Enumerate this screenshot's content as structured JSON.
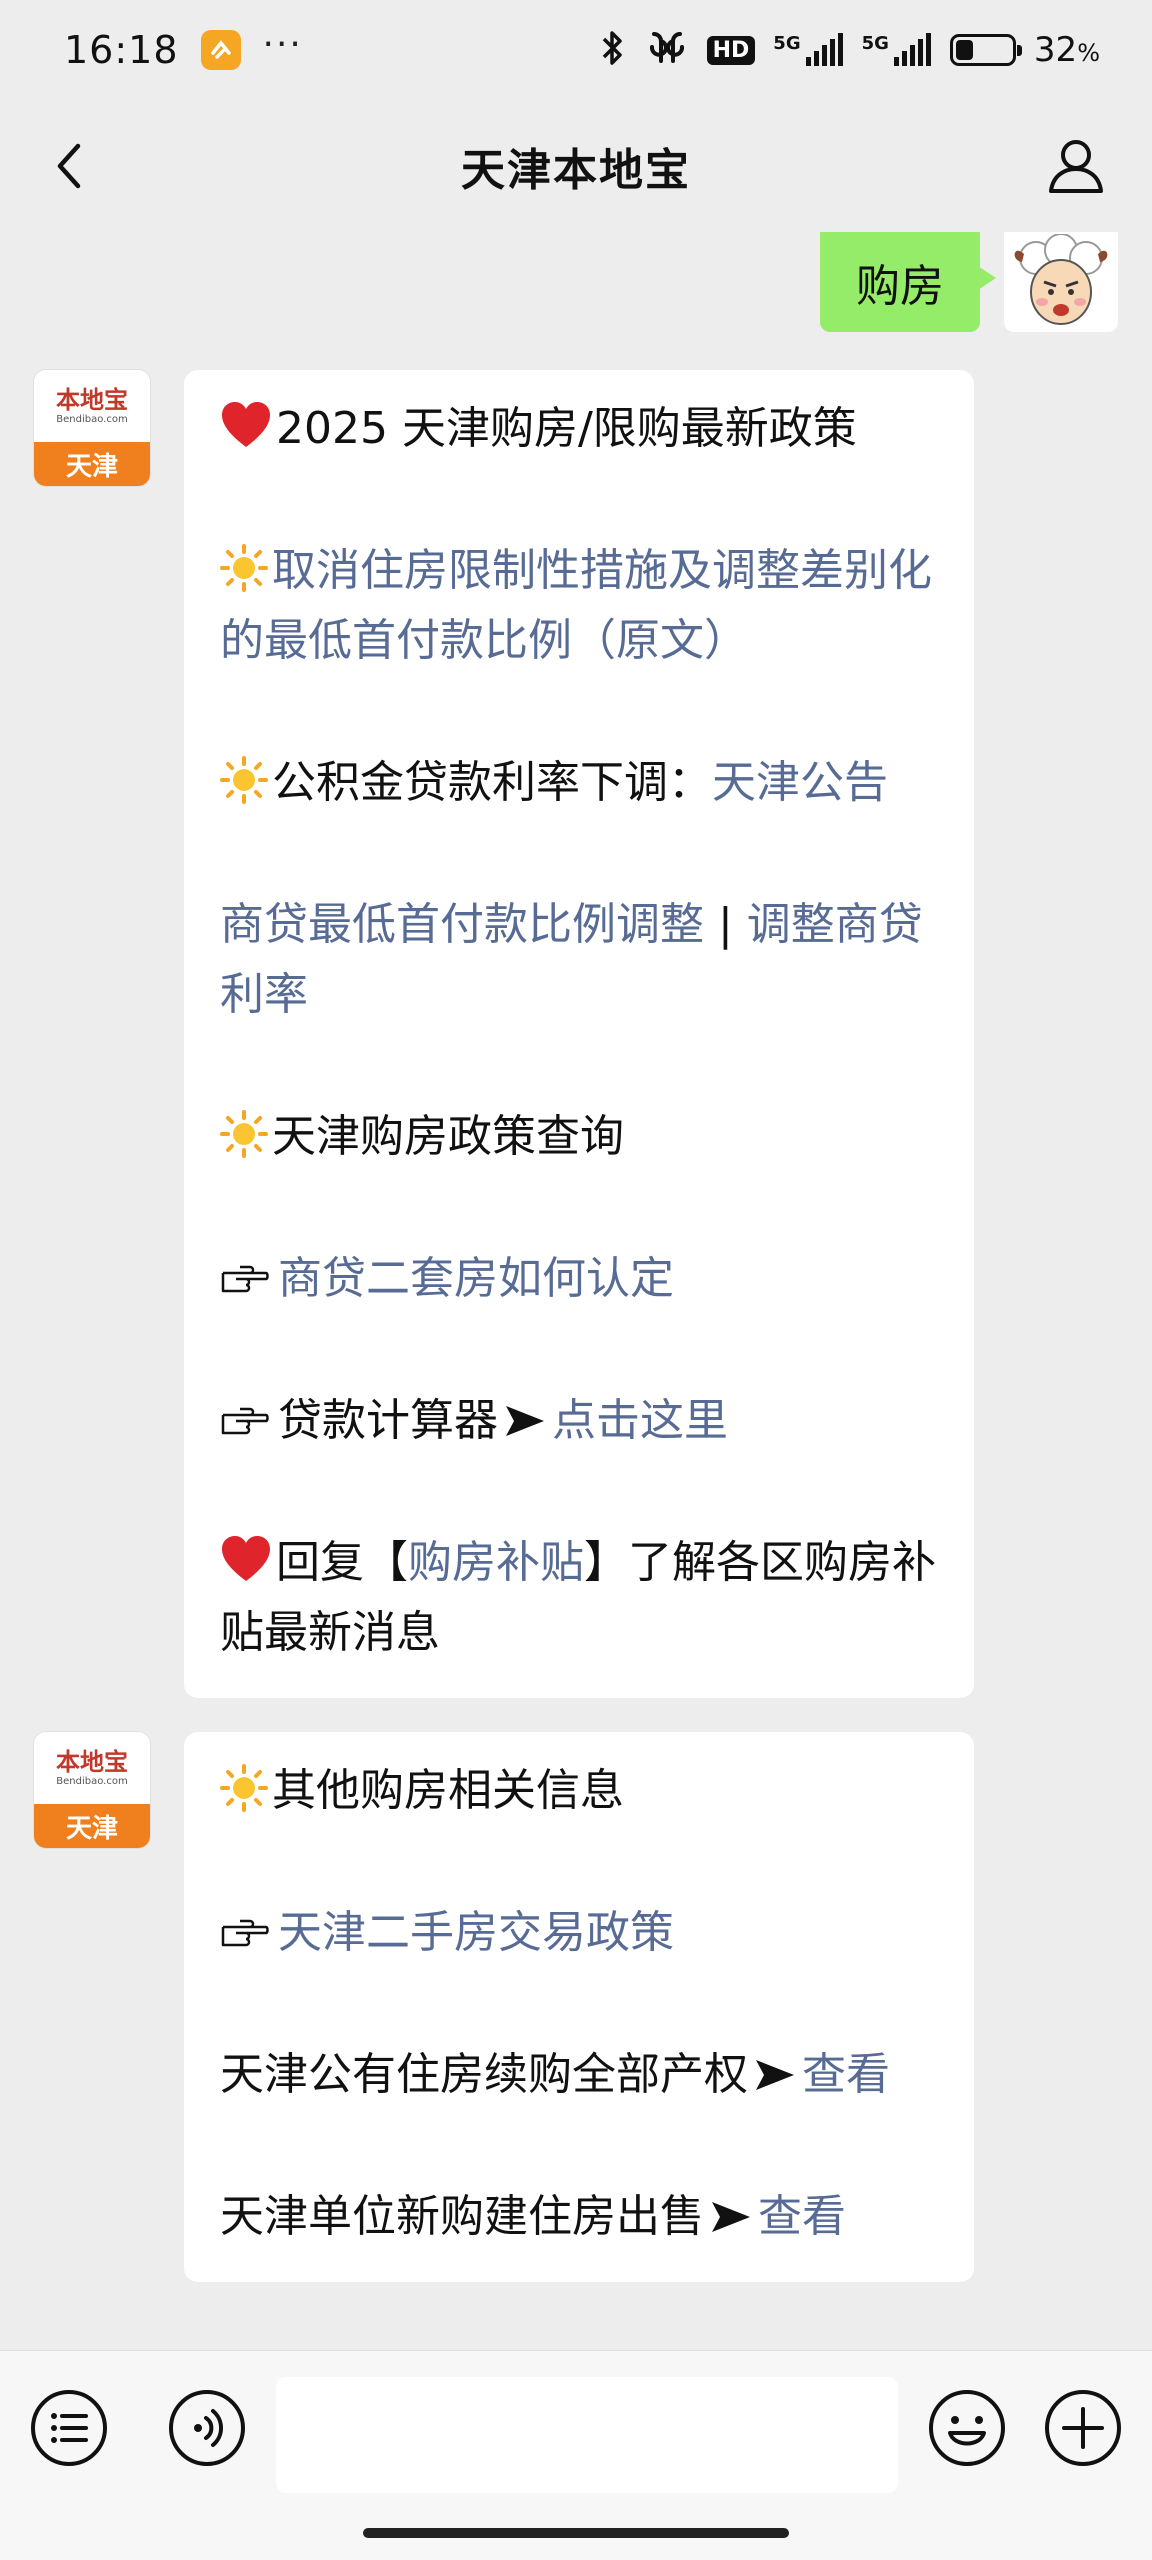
{
  "status_bar": {
    "time": "16:18",
    "dots": "···",
    "hd_label": "HD",
    "network_1": "5G",
    "network_2": "5G",
    "battery_percent": "32",
    "battery_unit": "%",
    "battery_level": 0.32
  },
  "header": {
    "title": "天津本地宝",
    "back_icon": "chevron-left-icon",
    "profile_icon": "user-icon"
  },
  "messages": {
    "outgoing": {
      "text": "购房"
    },
    "brand": {
      "name": "本地宝",
      "url": "Bendibao.com",
      "city": "天津"
    },
    "msg1": {
      "p1": "2025 天津购房/限购最新政策",
      "p2_link": "取消住房限制性措施及调整差别化的最低首付款比例（原文）",
      "p3_text": "公积金贷款利率下调：",
      "p3_link": "天津公告",
      "p4_link1": "商贷最低首付款比例调整",
      "p4_sep": " | ",
      "p4_link2": "调整商贷利率",
      "p5": "天津购房政策查询",
      "p6_link": "商贷二套房如何认定",
      "p7_text": "贷款计算器",
      "p7_link": "点击这里",
      "p8_text1": "回复【",
      "p8_link": "购房补贴",
      "p8_text2": "】了解各区购房补贴最新消息"
    },
    "msg2": {
      "p1": "其他购房相关信息",
      "p2_link": "天津二手房交易政策",
      "p3_text": "天津公有住房续购全部产权",
      "p3_link": "查看",
      "p4_text": "天津单位新购建住房出售",
      "p4_link": "查看"
    }
  },
  "bottom_bar": {
    "menu_icon": "list-menu-icon",
    "voice_icon": "voice-icon",
    "input_value": "",
    "emoji_icon": "smiley-icon",
    "plus_icon": "plus-icon"
  },
  "colors": {
    "link": "#576b95",
    "outgoing_bubble": "#95ec69",
    "brand_orange": "#f07f1e",
    "background": "#ededed"
  }
}
